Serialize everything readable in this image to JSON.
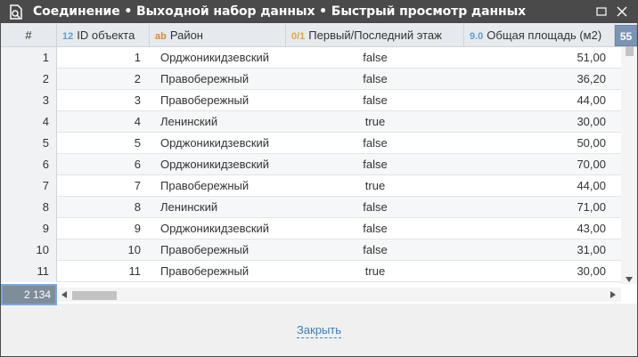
{
  "window": {
    "title": "Соединение • Выходной набор данных • Быстрый просмотр данных"
  },
  "columns": [
    {
      "key": "rownum",
      "label": "#",
      "type_icon": ""
    },
    {
      "key": "id",
      "label": "ID объекта",
      "type_icon": "12"
    },
    {
      "key": "district",
      "label": "Район",
      "type_icon": "ab"
    },
    {
      "key": "floor",
      "label": "Первый/Последний этаж",
      "type_icon": "0/1"
    },
    {
      "key": "area",
      "label": "Общая площадь (м2)",
      "type_icon": "9.0"
    }
  ],
  "column_count_badge": "55",
  "rows": [
    {
      "n": "1",
      "id": "1",
      "district": "Орджоникидзевский",
      "floor": "false",
      "area": "51,00"
    },
    {
      "n": "2",
      "id": "2",
      "district": "Правобережный",
      "floor": "false",
      "area": "36,20"
    },
    {
      "n": "3",
      "id": "3",
      "district": "Правобережный",
      "floor": "false",
      "area": "44,00"
    },
    {
      "n": "4",
      "id": "4",
      "district": "Ленинский",
      "floor": "true",
      "area": "30,00"
    },
    {
      "n": "5",
      "id": "5",
      "district": "Орджоникидзевский",
      "floor": "false",
      "area": "50,00"
    },
    {
      "n": "6",
      "id": "6",
      "district": "Орджоникидзевский",
      "floor": "false",
      "area": "70,00"
    },
    {
      "n": "7",
      "id": "7",
      "district": "Правобережный",
      "floor": "true",
      "area": "44,00"
    },
    {
      "n": "8",
      "id": "8",
      "district": "Ленинский",
      "floor": "false",
      "area": "71,00"
    },
    {
      "n": "9",
      "id": "9",
      "district": "Орджоникидзевский",
      "floor": "false",
      "area": "43,00"
    },
    {
      "n": "10",
      "id": "10",
      "district": "Правобережный",
      "floor": "false",
      "area": "31,00"
    },
    {
      "n": "11",
      "id": "11",
      "district": "Правобережный",
      "floor": "true",
      "area": "30,00"
    }
  ],
  "row_count_total": "2 134",
  "close_label": "Закрыть",
  "colors": {
    "titlebar": "#4a4a4a",
    "header": "#e6e9ed",
    "link": "#3a7fc4",
    "badge": "#7a94b5"
  }
}
